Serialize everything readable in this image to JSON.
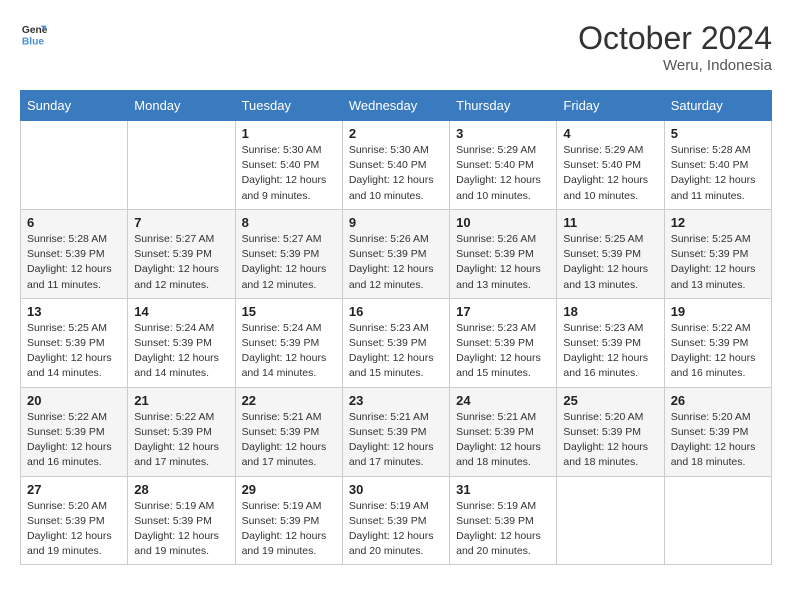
{
  "logo": {
    "line1": "General",
    "line2": "Blue"
  },
  "header": {
    "month": "October 2024",
    "location": "Weru, Indonesia"
  },
  "columns": [
    "Sunday",
    "Monday",
    "Tuesday",
    "Wednesday",
    "Thursday",
    "Friday",
    "Saturday"
  ],
  "weeks": [
    [
      {
        "day": "",
        "info": ""
      },
      {
        "day": "",
        "info": ""
      },
      {
        "day": "1",
        "info": "Sunrise: 5:30 AM\nSunset: 5:40 PM\nDaylight: 12 hours\nand 9 minutes."
      },
      {
        "day": "2",
        "info": "Sunrise: 5:30 AM\nSunset: 5:40 PM\nDaylight: 12 hours\nand 10 minutes."
      },
      {
        "day": "3",
        "info": "Sunrise: 5:29 AM\nSunset: 5:40 PM\nDaylight: 12 hours\nand 10 minutes."
      },
      {
        "day": "4",
        "info": "Sunrise: 5:29 AM\nSunset: 5:40 PM\nDaylight: 12 hours\nand 10 minutes."
      },
      {
        "day": "5",
        "info": "Sunrise: 5:28 AM\nSunset: 5:40 PM\nDaylight: 12 hours\nand 11 minutes."
      }
    ],
    [
      {
        "day": "6",
        "info": "Sunrise: 5:28 AM\nSunset: 5:39 PM\nDaylight: 12 hours\nand 11 minutes."
      },
      {
        "day": "7",
        "info": "Sunrise: 5:27 AM\nSunset: 5:39 PM\nDaylight: 12 hours\nand 12 minutes."
      },
      {
        "day": "8",
        "info": "Sunrise: 5:27 AM\nSunset: 5:39 PM\nDaylight: 12 hours\nand 12 minutes."
      },
      {
        "day": "9",
        "info": "Sunrise: 5:26 AM\nSunset: 5:39 PM\nDaylight: 12 hours\nand 12 minutes."
      },
      {
        "day": "10",
        "info": "Sunrise: 5:26 AM\nSunset: 5:39 PM\nDaylight: 12 hours\nand 13 minutes."
      },
      {
        "day": "11",
        "info": "Sunrise: 5:25 AM\nSunset: 5:39 PM\nDaylight: 12 hours\nand 13 minutes."
      },
      {
        "day": "12",
        "info": "Sunrise: 5:25 AM\nSunset: 5:39 PM\nDaylight: 12 hours\nand 13 minutes."
      }
    ],
    [
      {
        "day": "13",
        "info": "Sunrise: 5:25 AM\nSunset: 5:39 PM\nDaylight: 12 hours\nand 14 minutes."
      },
      {
        "day": "14",
        "info": "Sunrise: 5:24 AM\nSunset: 5:39 PM\nDaylight: 12 hours\nand 14 minutes."
      },
      {
        "day": "15",
        "info": "Sunrise: 5:24 AM\nSunset: 5:39 PM\nDaylight: 12 hours\nand 14 minutes."
      },
      {
        "day": "16",
        "info": "Sunrise: 5:23 AM\nSunset: 5:39 PM\nDaylight: 12 hours\nand 15 minutes."
      },
      {
        "day": "17",
        "info": "Sunrise: 5:23 AM\nSunset: 5:39 PM\nDaylight: 12 hours\nand 15 minutes."
      },
      {
        "day": "18",
        "info": "Sunrise: 5:23 AM\nSunset: 5:39 PM\nDaylight: 12 hours\nand 16 minutes."
      },
      {
        "day": "19",
        "info": "Sunrise: 5:22 AM\nSunset: 5:39 PM\nDaylight: 12 hours\nand 16 minutes."
      }
    ],
    [
      {
        "day": "20",
        "info": "Sunrise: 5:22 AM\nSunset: 5:39 PM\nDaylight: 12 hours\nand 16 minutes."
      },
      {
        "day": "21",
        "info": "Sunrise: 5:22 AM\nSunset: 5:39 PM\nDaylight: 12 hours\nand 17 minutes."
      },
      {
        "day": "22",
        "info": "Sunrise: 5:21 AM\nSunset: 5:39 PM\nDaylight: 12 hours\nand 17 minutes."
      },
      {
        "day": "23",
        "info": "Sunrise: 5:21 AM\nSunset: 5:39 PM\nDaylight: 12 hours\nand 17 minutes."
      },
      {
        "day": "24",
        "info": "Sunrise: 5:21 AM\nSunset: 5:39 PM\nDaylight: 12 hours\nand 18 minutes."
      },
      {
        "day": "25",
        "info": "Sunrise: 5:20 AM\nSunset: 5:39 PM\nDaylight: 12 hours\nand 18 minutes."
      },
      {
        "day": "26",
        "info": "Sunrise: 5:20 AM\nSunset: 5:39 PM\nDaylight: 12 hours\nand 18 minutes."
      }
    ],
    [
      {
        "day": "27",
        "info": "Sunrise: 5:20 AM\nSunset: 5:39 PM\nDaylight: 12 hours\nand 19 minutes."
      },
      {
        "day": "28",
        "info": "Sunrise: 5:19 AM\nSunset: 5:39 PM\nDaylight: 12 hours\nand 19 minutes."
      },
      {
        "day": "29",
        "info": "Sunrise: 5:19 AM\nSunset: 5:39 PM\nDaylight: 12 hours\nand 19 minutes."
      },
      {
        "day": "30",
        "info": "Sunrise: 5:19 AM\nSunset: 5:39 PM\nDaylight: 12 hours\nand 20 minutes."
      },
      {
        "day": "31",
        "info": "Sunrise: 5:19 AM\nSunset: 5:39 PM\nDaylight: 12 hours\nand 20 minutes."
      },
      {
        "day": "",
        "info": ""
      },
      {
        "day": "",
        "info": ""
      }
    ]
  ]
}
